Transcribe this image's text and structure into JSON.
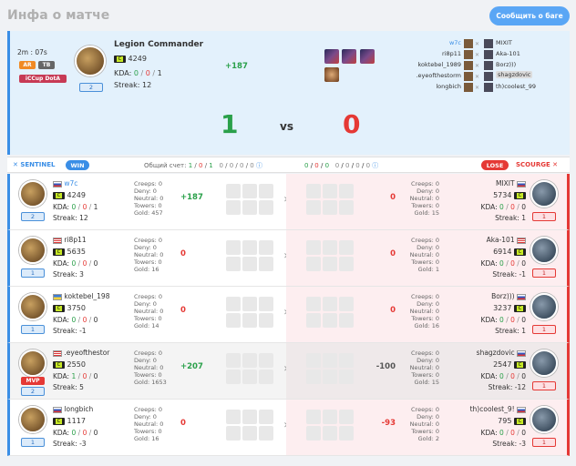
{
  "page": {
    "title": "Инфа о матче",
    "report_button": "Сообщить о баге"
  },
  "summary": {
    "duration": "2m : 07s",
    "modes": [
      "AR",
      "TB"
    ],
    "league": "iCCup DotA",
    "player_name": "Legion Commander",
    "rating": "4249",
    "kda_label": "KDA:",
    "kills": "0",
    "deaths": "0",
    "assists": "1",
    "streak_label": "Streak:",
    "streak": "12",
    "level": "2",
    "delta": "+187",
    "score_left": "1",
    "vs": "vs",
    "score_right": "0",
    "lineup": [
      {
        "left": "w7c",
        "right": "MIXIT"
      },
      {
        "left": "ri8p11",
        "right": "Aka-101"
      },
      {
        "left": "koktebel_1989",
        "right": "Borz)))"
      },
      {
        "left": ".eyeofthestorm",
        "right": "shagzdovic"
      },
      {
        "left": "longbich",
        "right": "th)coolest_99"
      }
    ]
  },
  "bar": {
    "sentinel": "SENTINEL",
    "win": "WIN",
    "total_label": "Общий счет:",
    "left_score": [
      "1",
      "0",
      "1",
      "0",
      "0",
      "0",
      "0"
    ],
    "right_score": [
      "0",
      "0",
      "0",
      "0",
      "0",
      "0",
      "0"
    ],
    "lose": "LOSE",
    "scourge": "SCOURGE"
  },
  "labels": {
    "creeps": "Creeps:",
    "deny": "Deny:",
    "neutral": "Neutral:",
    "towers": "Towers:",
    "gold": "Gold:",
    "kda": "KDA:",
    "streak": "Streak:",
    "mvp": "MVP"
  },
  "rows": [
    {
      "left": {
        "name": "w7c",
        "rating": "4249",
        "k": "0",
        "d": "0",
        "a": "1",
        "streak": "12",
        "level": "2",
        "creeps": "0",
        "deny": "0",
        "neutral": "0",
        "towers": "0",
        "gold": "457",
        "delta": "+187"
      },
      "right": {
        "name": "MIXIT",
        "rating": "5734",
        "k": "0",
        "d": "0",
        "a": "0",
        "streak": "1",
        "level": "1",
        "creeps": "0",
        "deny": "0",
        "neutral": "0",
        "towers": "0",
        "gold": "15",
        "delta": "0"
      }
    },
    {
      "left": {
        "name": "ri8p11",
        "rating": "5635",
        "k": "0",
        "d": "0",
        "a": "0",
        "streak": "3",
        "level": "1",
        "creeps": "0",
        "deny": "0",
        "neutral": "0",
        "towers": "0",
        "gold": "16",
        "delta": "0"
      },
      "right": {
        "name": "Aka-101",
        "rating": "6914",
        "k": "0",
        "d": "0",
        "a": "0",
        "streak": "-1",
        "level": "1",
        "creeps": "0",
        "deny": "0",
        "neutral": "0",
        "towers": "0",
        "gold": "1",
        "delta": "0"
      }
    },
    {
      "left": {
        "name": "koktebel_198",
        "rating": "3750",
        "k": "0",
        "d": "0",
        "a": "0",
        "streak": "-1",
        "level": "1",
        "creeps": "0",
        "deny": "0",
        "neutral": "0",
        "towers": "0",
        "gold": "14",
        "delta": "0"
      },
      "right": {
        "name": "Borz)))",
        "rating": "3237",
        "k": "0",
        "d": "0",
        "a": "0",
        "streak": "1",
        "level": "1",
        "creeps": "0",
        "deny": "0",
        "neutral": "0",
        "towers": "0",
        "gold": "16",
        "delta": "0"
      }
    },
    {
      "left": {
        "name": ".eyeofthestor",
        "rating": "2550",
        "k": "1",
        "d": "0",
        "a": "0",
        "streak": "5",
        "level": "2",
        "creeps": "0",
        "deny": "0",
        "neutral": "0",
        "towers": "0",
        "gold": "1653",
        "delta": "+207"
      },
      "right": {
        "name": "shagzdovic",
        "rating": "2547",
        "k": "0",
        "d": "0",
        "a": "0",
        "streak": "-12",
        "level": "1",
        "creeps": "0",
        "deny": "0",
        "neutral": "0",
        "towers": "0",
        "gold": "15",
        "delta": "-100"
      }
    },
    {
      "left": {
        "name": "longbich",
        "rating": "1117",
        "k": "0",
        "d": "0",
        "a": "0",
        "streak": "-3",
        "level": "1",
        "creeps": "0",
        "deny": "0",
        "neutral": "0",
        "towers": "0",
        "gold": "16",
        "delta": "0"
      },
      "right": {
        "name": "th)coolest_9!",
        "rating": "795",
        "k": "0",
        "d": "0",
        "a": "0",
        "streak": "-3",
        "level": "1",
        "creeps": "0",
        "deny": "0",
        "neutral": "0",
        "towers": "0",
        "gold": "2",
        "delta": "-93"
      }
    }
  ]
}
